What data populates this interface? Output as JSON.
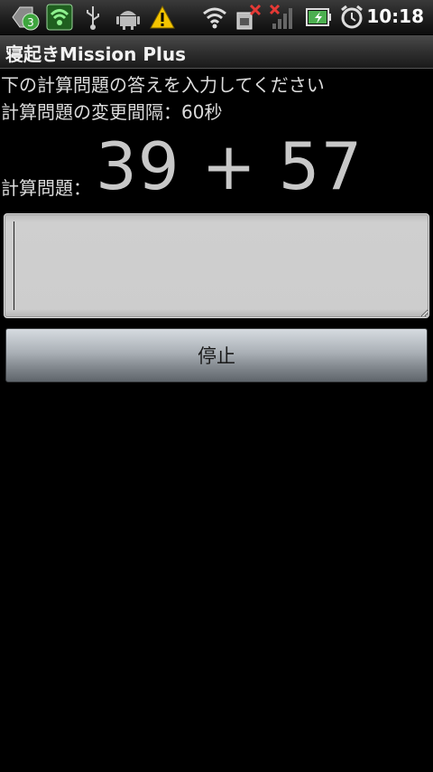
{
  "status_bar": {
    "notification_count": "3",
    "time": "10:18",
    "icons": [
      "notification-badge-icon",
      "shield-icon",
      "usb-icon",
      "android-icon",
      "warning-icon",
      "wifi-icon",
      "sim-error-icon",
      "signal-off-icon",
      "battery-charging-icon",
      "alarm-clock-icon"
    ]
  },
  "titlebar": {
    "title": "寝起きMission Plus"
  },
  "main": {
    "instruction": "下の計算問題の答えを入力してください",
    "interval": "計算問題の変更間隔：60秒",
    "problem_label": "計算問題：",
    "problem": "39 + 57",
    "answer_value": "",
    "stop_label": "停止"
  },
  "colors": {
    "background": "#000000",
    "warning": "#f5c400",
    "shield": "#4caf50"
  }
}
